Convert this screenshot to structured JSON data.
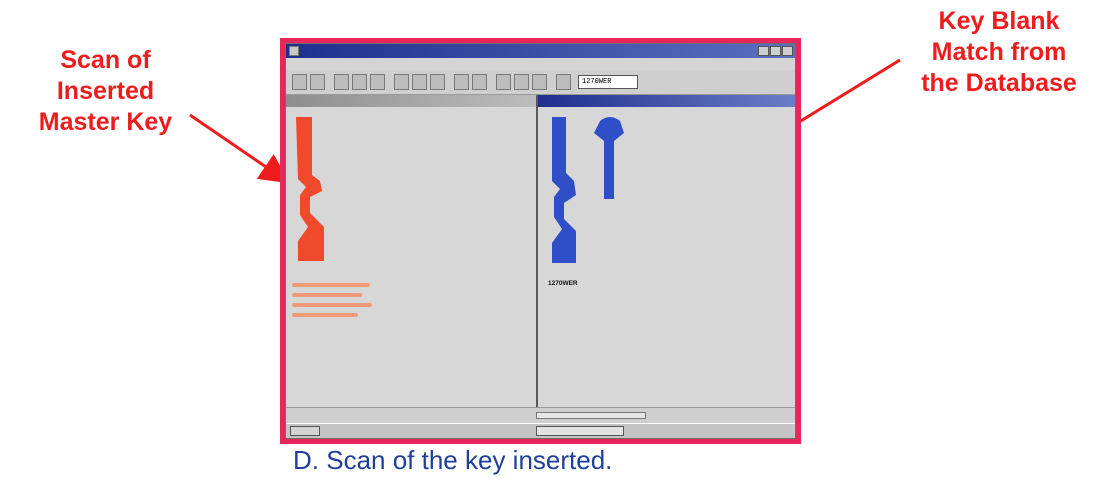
{
  "callouts": {
    "left": [
      "Scan of",
      "Inserted",
      "Master Key"
    ],
    "right": [
      "Key Blank",
      "Match from",
      "the Database"
    ]
  },
  "caption": "D. Scan of the key inserted.",
  "colors": {
    "callout": "#ee1c1c",
    "frame": "#e8265a",
    "scan_key": "#f04a2a",
    "match_key": "#2f4fc8",
    "caption": "#1f3f9a"
  },
  "screenshot": {
    "icons": [
      "app-icon",
      "minimize-icon",
      "maximize-icon",
      "close-icon",
      "toolbar-icon",
      "start-icon"
    ],
    "toolbar_select_value": "1270WER",
    "key_info": [
      "1270WER"
    ]
  }
}
